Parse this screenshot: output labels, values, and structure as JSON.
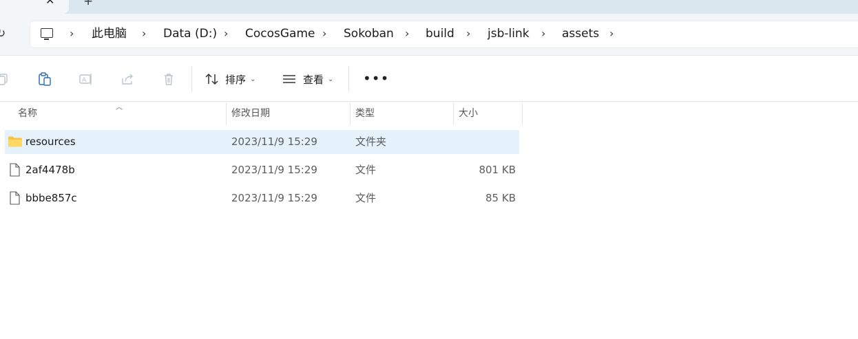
{
  "tabs": {
    "close_glyph": "✕",
    "new_glyph": "+"
  },
  "address": {
    "crumbs": [
      "此电脑",
      "Data (D:)",
      "CocosGame",
      "Sokoban",
      "build",
      "jsb-link",
      "assets"
    ],
    "separator": "›"
  },
  "toolbar": {
    "sort_label": "排序",
    "view_label": "查看",
    "more_label": "•••"
  },
  "columns": {
    "name": "名称",
    "date": "修改日期",
    "type": "类型",
    "size": "大小"
  },
  "files": [
    {
      "name": "resources",
      "date": "2023/11/9 15:29",
      "type": "文件夹",
      "size": "",
      "kind": "folder",
      "selected": true
    },
    {
      "name": "2af4478b",
      "date": "2023/11/9 15:29",
      "type": "文件",
      "size": "801 KB",
      "kind": "file",
      "selected": false
    },
    {
      "name": "bbbe857c",
      "date": "2023/11/9 15:29",
      "type": "文件",
      "size": "85 KB",
      "kind": "file",
      "selected": false
    }
  ],
  "colors": {
    "selection": "#e5f1fb",
    "folder": "#f5c542",
    "accent": "#0067c0"
  }
}
